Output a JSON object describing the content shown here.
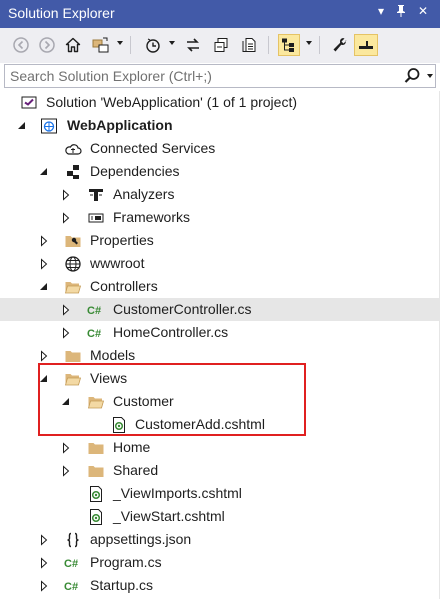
{
  "window": {
    "title": "Solution Explorer",
    "menu_glyph": "▾",
    "pin_glyph": "📌",
    "close_glyph": "✕"
  },
  "search": {
    "placeholder": "Search Solution Explorer (Ctrl+;)"
  },
  "tree": {
    "solution": "Solution 'WebApplication' (1 of 1 project)",
    "project": "WebApplication",
    "connected_services": "Connected Services",
    "dependencies": "Dependencies",
    "analyzers": "Analyzers",
    "frameworks": "Frameworks",
    "properties": "Properties",
    "wwwroot": "wwwroot",
    "controllers": "Controllers",
    "customer_controller": "CustomerController.cs",
    "home_controller": "HomeController.cs",
    "models": "Models",
    "views": "Views",
    "customer": "Customer",
    "customer_add": "CustomerAdd.cshtml",
    "home": "Home",
    "shared": "Shared",
    "view_imports": "_ViewImports.cshtml",
    "view_start": "_ViewStart.cshtml",
    "appsettings": "appsettings.json",
    "program": "Program.cs",
    "startup": "Startup.cs"
  },
  "colors": {
    "title_bar": "#425aa8",
    "toolbar": "#eeeef2",
    "selected_row": "#e6e6e6",
    "folder": "#dcb67a",
    "csharp": "#388a34",
    "highlight": "#e02020"
  }
}
